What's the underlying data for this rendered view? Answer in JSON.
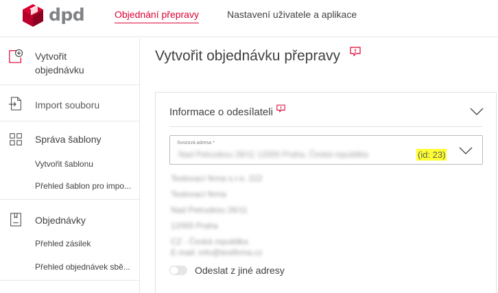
{
  "brand": {
    "logo_text": "dpd",
    "accent": "#dc0032"
  },
  "nav": {
    "tabs": [
      {
        "label": "Objednání přepravy",
        "active": true
      },
      {
        "label": "Nastavení uživatele a aplikace",
        "active": false
      }
    ]
  },
  "sidebar": {
    "create_order": {
      "label_line1": "Vytvořit",
      "label_line2": "objednávku",
      "icon": "add-document-icon"
    },
    "import_file": {
      "label": "Import souboru",
      "icon": "import-file-icon"
    },
    "templates": {
      "label": "Správa šablony",
      "icon": "grid-icon",
      "items": [
        "Vytvořit šablonu",
        "Přehled šablon pro impo..."
      ]
    },
    "orders": {
      "label": "Objednávky",
      "icon": "package-icon",
      "items": [
        "Přehled zásilek",
        "Přehled objednávek sbě..."
      ]
    }
  },
  "main": {
    "title": "Vytvořit objednávku přepravy",
    "sender_section": {
      "title": "Informace o odesílateli",
      "pickup_select": {
        "label": "Svozová adresa *",
        "value": "Nad Petruskou 26/11 12000 Praha, Česká republika",
        "id_text": "(id: 23)",
        "highlight": "#ffff33"
      },
      "address_lines": [
        "Testovací firma s.r.o. 222",
        "Testovací firma",
        "Nad Petruskou 26/11",
        "12000 Praha",
        "CZ - Česká republika",
        "E-mail: info@testfirma.cz"
      ],
      "other_address_toggle": {
        "label": "Odeslat z jiné adresy",
        "on": false
      }
    }
  }
}
